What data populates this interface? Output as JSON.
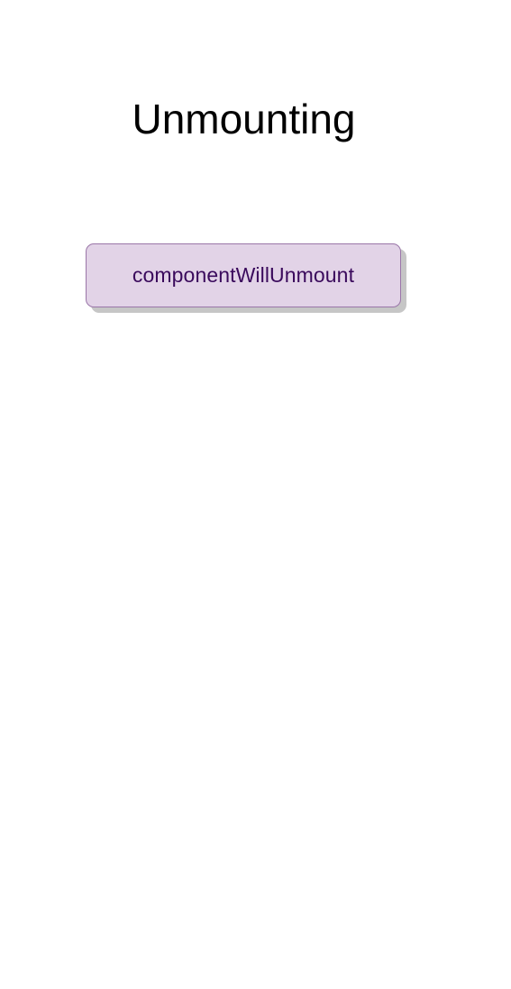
{
  "diagram": {
    "title": "Unmounting",
    "nodes": [
      {
        "id": "component-will-unmount",
        "label": "componentWillUnmount",
        "fill_color": "#e2d3e7",
        "border_color": "#9a76a8",
        "text_color": "#3a0a5c",
        "shadow_color": "#c6c6c6"
      }
    ]
  }
}
